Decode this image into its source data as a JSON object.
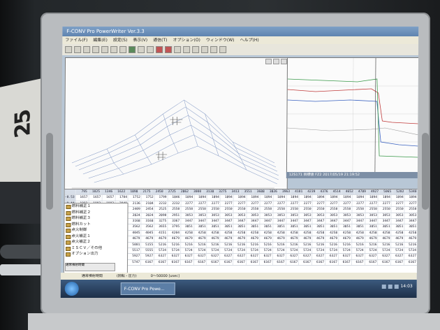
{
  "window": {
    "title": "F-CONV Pro PowerWriter Ver.3.3"
  },
  "menu": [
    "ファイル(F)",
    "編集(E)",
    "設定(S)",
    "表示(V)",
    "通信(T)",
    "オプション(O)",
    "ウィンドウ(W)",
    "ヘルプ(H)"
  ],
  "log_header": "12S171 目標値 FZ2  2017/05/19 21:19:52",
  "table": {
    "header": [
      "",
      "795",
      "1025",
      "1346",
      "1622",
      "1898",
      "2175",
      "2450",
      "2725",
      "2862",
      "3000",
      "3138",
      "3275",
      "3413",
      "3551",
      "3688",
      "3826",
      "3963",
      "4101",
      "4239",
      "4376",
      "4514",
      "4652",
      "4789",
      "4927",
      "5065",
      "5202",
      "5340"
    ],
    "rows": [
      [
        "-0.53",
        "1657",
        "1657",
        "1657",
        "1704",
        "1752",
        "1752",
        "1799",
        "1846",
        "1894",
        "1894",
        "1894",
        "1894",
        "1894",
        "1894",
        "1894",
        "1894",
        "1894",
        "1894",
        "1894",
        "1894",
        "1894",
        "1894",
        "1894",
        "1894",
        "1894",
        "1894"
      ],
      [
        "-0.44",
        "1992",
        "1992",
        "1992",
        "2040",
        "2136",
        "2184",
        "2232",
        "2232",
        "2277",
        "2277",
        "2277",
        "2277",
        "2277",
        "2277",
        "2277",
        "2277",
        "2277",
        "2277",
        "2277",
        "2277",
        "2277",
        "2277",
        "2277",
        "2277",
        "2277",
        "2277"
      ],
      [
        "-0.35",
        "2409",
        "2409",
        "2328",
        "2390",
        "2409",
        "2454",
        "2525",
        "2550",
        "2550",
        "2550",
        "2550",
        "2550",
        "2550",
        "2550",
        "2550",
        "2550",
        "2550",
        "2550",
        "2550",
        "2550",
        "2550",
        "2550",
        "2550",
        "2550",
        "2550",
        "2550"
      ],
      [
        "-0.26",
        "2658",
        "2671",
        "2707",
        "2768",
        "2824",
        "2824",
        "2890",
        "2951",
        "3053",
        "3053",
        "3053",
        "3053",
        "3053",
        "3053",
        "3053",
        "3053",
        "3053",
        "3053",
        "3053",
        "3053",
        "3053",
        "3053",
        "3053",
        "3053",
        "3053",
        "3053"
      ],
      [
        "-0.17",
        "3010",
        "3010",
        "3010",
        "3102",
        "3168",
        "3168",
        "3275",
        "3367",
        "3447",
        "3447",
        "3447",
        "3447",
        "3447",
        "3447",
        "3447",
        "3447",
        "3447",
        "3447",
        "3447",
        "3447",
        "3447",
        "3447",
        "3447",
        "3447",
        "3447",
        "3447"
      ],
      [
        "-0.08",
        "3469",
        "3469",
        "3469",
        "3469",
        "3562",
        "3562",
        "3655",
        "3795",
        "3851",
        "3851",
        "3851",
        "3851",
        "3851",
        "3851",
        "3851",
        "3851",
        "3851",
        "3851",
        "3851",
        "3851",
        "3851",
        "3851",
        "3851",
        "3851",
        "3851",
        "3851"
      ],
      [
        "0.01",
        "3938",
        "3938",
        "3938",
        "3938",
        "4045",
        "4045",
        "4151",
        "4204",
        "4258",
        "4258",
        "4258",
        "4258",
        "4258",
        "4258",
        "4258",
        "4258",
        "4258",
        "4258",
        "4258",
        "4258",
        "4258",
        "4258",
        "4258",
        "4258",
        "4258",
        "4258"
      ],
      [
        "0.10",
        "4323",
        "4323",
        "4442",
        "4559",
        "4679",
        "4679",
        "4679",
        "4679",
        "4679",
        "4679",
        "4679",
        "4679",
        "4679",
        "4679",
        "4679",
        "4679",
        "4679",
        "4679",
        "4679",
        "4679",
        "4679",
        "4679",
        "4679",
        "4679",
        "4679",
        "4679"
      ],
      [
        "0.19",
        "4607",
        "4607",
        "4607",
        "4868",
        "5001",
        "5155",
        "5216",
        "5216",
        "5216",
        "5216",
        "5216",
        "5216",
        "5216",
        "5216",
        "5216",
        "5216",
        "5216",
        "5216",
        "5216",
        "5216",
        "5216",
        "5216",
        "5216",
        "5216",
        "5216",
        "5216"
      ],
      [
        "0.28",
        "5078",
        "5078",
        "5078",
        "5440",
        "5517",
        "5555",
        "5724",
        "5724",
        "5724",
        "5724",
        "5724",
        "5724",
        "5724",
        "5724",
        "5724",
        "5724",
        "5724",
        "5724",
        "5724",
        "5724",
        "5724",
        "5724",
        "5724",
        "5724",
        "5724",
        "5724"
      ],
      [
        "0.37",
        "5535",
        "5535",
        "5535",
        "5535",
        "5927",
        "5927",
        "6327",
        "6327",
        "6327",
        "6327",
        "6327",
        "6327",
        "6327",
        "6327",
        "6327",
        "6327",
        "6327",
        "6327",
        "6327",
        "6327",
        "6327",
        "6327",
        "6327",
        "6327",
        "6327",
        "6327"
      ],
      [
        "0.46",
        "5747",
        "5747",
        "5747",
        "5747",
        "5747",
        "6167",
        "6167",
        "6167",
        "6167",
        "6167",
        "6167",
        "6167",
        "6167",
        "6167",
        "6167",
        "6167",
        "6167",
        "6167",
        "6167",
        "6167",
        "6167",
        "6167",
        "6167",
        "6167",
        "6167",
        "6167"
      ]
    ]
  },
  "tree": [
    "燃料補正１",
    "燃料補正２",
    "燃料補正３",
    "燃料カット",
    "点火制御",
    "点火補正１",
    "点火補正２",
    "ＩＳＣＶ／その他",
    "オプション出力"
  ],
  "minibox": "通常噴射時間",
  "status": [
    "通常噴射時間",
    "(回転 - 圧力)",
    "0〜50000 [usec]"
  ],
  "taskbar": {
    "app_label": "F-CONV Pro Powe...",
    "clock": "14:03"
  },
  "calendar_number": "25"
}
